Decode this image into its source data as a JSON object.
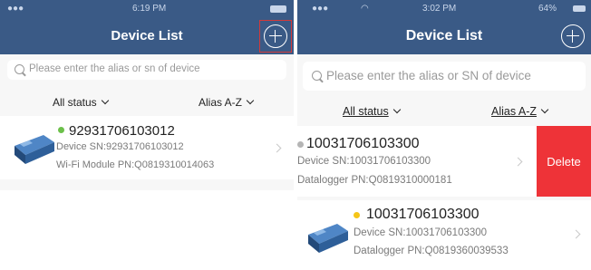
{
  "left": {
    "status_time": "6:19 PM",
    "nav_title": "Device List",
    "search_placeholder": "Please enter the alias or sn of device",
    "filter_status": "All status",
    "filter_sort": "Alias A-Z",
    "devices": [
      {
        "name": "92931706103012",
        "sn_line": "Device SN:92931706103012",
        "pn_line": "Wi-Fi Module PN:Q0819310014063",
        "status_color": "#6cc04a"
      }
    ]
  },
  "right": {
    "status_time": "3:02 PM",
    "status_battery": "64%",
    "nav_title": "Device List",
    "search_placeholder": "Please enter the alias or SN of device",
    "filter_status": "All status",
    "filter_sort": "Alias A-Z",
    "devices": [
      {
        "name": "10031706103300",
        "sn_line": "Device SN:10031706103300",
        "pn_line": "Datalogger PN:Q0819310000181",
        "status_color": "#b5b5b5",
        "delete_label": "Delete"
      },
      {
        "name": "10031706103300",
        "sn_line": "Device SN:10031706103300",
        "pn_line": "Datalogger PN:Q0819360039533",
        "status_color": "#f5c518"
      }
    ]
  },
  "colors": {
    "navbar": "#3a5a86",
    "delete": "#ee3338",
    "highlight": "#d23a3a"
  }
}
